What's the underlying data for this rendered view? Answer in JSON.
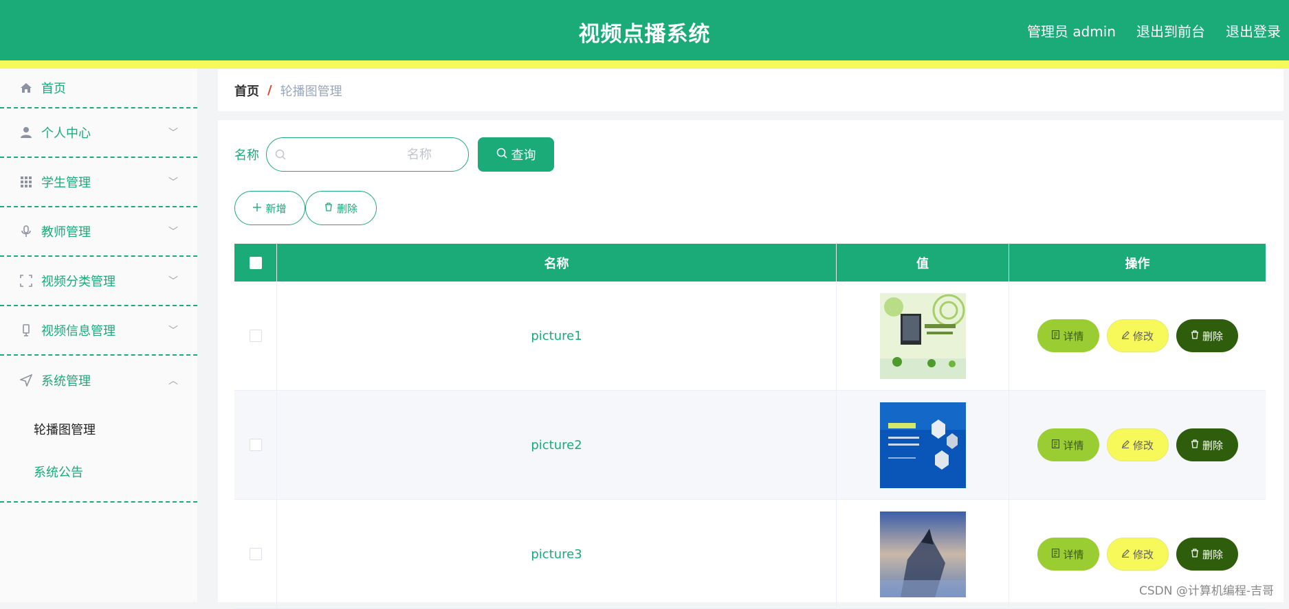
{
  "header": {
    "title": "视频点播系统",
    "admin": "管理员 admin",
    "to_front": "退出到前台",
    "logout": "退出登录"
  },
  "sidebar": {
    "items": [
      {
        "label": "首页",
        "icon": "home-icon"
      },
      {
        "label": "个人中心",
        "icon": "user-icon"
      },
      {
        "label": "学生管理",
        "icon": "grid-icon"
      },
      {
        "label": "教师管理",
        "icon": "microphone-icon"
      },
      {
        "label": "视频分类管理",
        "icon": "frame-icon"
      },
      {
        "label": "视频信息管理",
        "icon": "device-icon"
      },
      {
        "label": "系统管理",
        "icon": "send-icon"
      }
    ],
    "sub_items": [
      "轮播图管理",
      "系统公告"
    ]
  },
  "breadcrumb": {
    "home": "首页",
    "separator": "/",
    "current": "轮播图管理"
  },
  "search": {
    "label": "名称",
    "placeholder": "名称",
    "query_button": "查询"
  },
  "actions": {
    "add": "新增",
    "delete": "删除"
  },
  "table": {
    "headers": [
      "名称",
      "值",
      "操作"
    ],
    "rows": [
      {
        "name": "picture1"
      },
      {
        "name": "picture2"
      },
      {
        "name": "picture3"
      }
    ],
    "row_actions": {
      "detail": "详情",
      "edit": "修改",
      "delete": "删除"
    }
  },
  "watermark": "CSDN @计算机编程-吉哥",
  "colors": {
    "primary": "#1aab78",
    "accent_yellow": "#f6f95a",
    "detail_green": "#9acd32",
    "delete_dark": "#2e5e0b"
  }
}
